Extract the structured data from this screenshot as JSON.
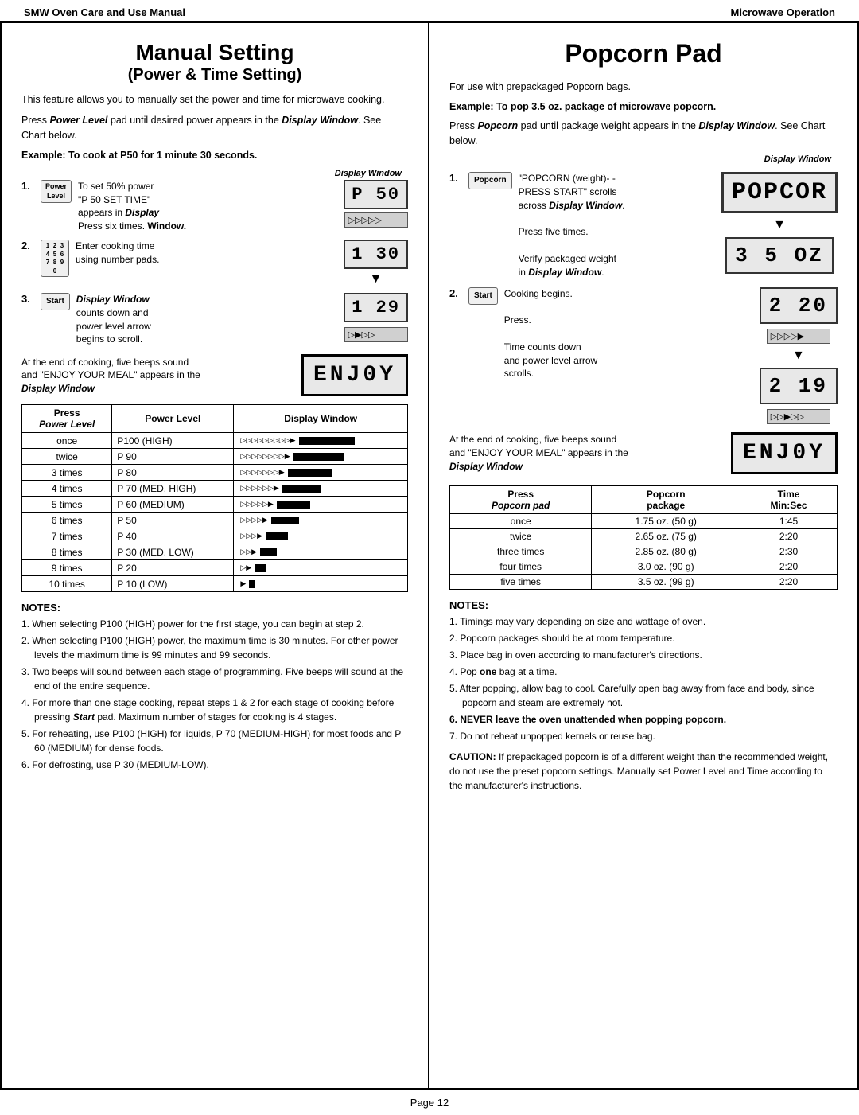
{
  "header": {
    "left": "SMW Oven Care and Use Manual",
    "right": "Microwave Operation"
  },
  "left": {
    "title_main": "Manual Setting",
    "title_sub": "(Power & Time Setting)",
    "intro1": "This feature allows you to manually set the power and time for microwave cooking.",
    "intro2": "Press Power Level pad until desired power appears in the Display Window. See Chart below.",
    "example_label": "Example: To cook at P50 for 1 minute 30 seconds.",
    "display_window_label": "Display Window",
    "steps": [
      {
        "num": "1.",
        "button": "Power\nLevel",
        "text_main": "To set 50% power\n\"P 50  SET TIME\"\nappears in ",
        "text_bold_italic": "Display",
        "text_after": "\nPress six times. ",
        "text_bold": "Window.",
        "display_val": "P 50",
        "display_val2": null
      },
      {
        "num": "2.",
        "button": "1 2 3\n4 5 6\n7 8 9\n0",
        "text_main": "Enter cooking time\nusing number pads.",
        "display_val": "1 30",
        "display_val2": null
      },
      {
        "num": "3.",
        "button": "Start",
        "text_label": "Display Window",
        "text_main": "counts down and\npower level arrow\nbegins to scroll.",
        "display_val": "1 29",
        "display_val2": null
      }
    ],
    "enjoy_text": "At the end of cooking, five beeps sound\nand \"ENJOY YOUR MEAL\" appears in the\nDisplay Window",
    "enjoy_val": "ENJ0Y",
    "power_table": {
      "headers": [
        "Press\nPower Level",
        "Power Level",
        "Display Window"
      ],
      "rows": [
        {
          "press": "once",
          "level": "P100 (HIGH)",
          "bars": 10
        },
        {
          "press": "twice",
          "level": "P 90",
          "bars": 9
        },
        {
          "press": "3 times",
          "level": "P 80",
          "bars": 8
        },
        {
          "press": "4 times",
          "level": "P 70 (MED. HIGH)",
          "bars": 7
        },
        {
          "press": "5 times",
          "level": "P 60 (MEDIUM)",
          "bars": 6
        },
        {
          "press": "6 times",
          "level": "P 50",
          "bars": 5
        },
        {
          "press": "7 times",
          "level": "P 40",
          "bars": 4
        },
        {
          "press": "8 times",
          "level": "P 30 (MED. LOW)",
          "bars": 3
        },
        {
          "press": "9 times",
          "level": "P 20",
          "bars": 2
        },
        {
          "press": "10 times",
          "level": "P 10 (LOW)",
          "bars": 1
        }
      ]
    },
    "notes_title": "NOTES:",
    "notes": [
      "1. When selecting P100 (HIGH) power for the first stage, you can begin at step 2.",
      "2. When selecting P100 (HIGH) power, the maximum time is 30 minutes. For other power levels the maximum time is 99 minutes and 99 seconds.",
      "3. Two beeps will sound between each stage of programming. Five beeps will sound at the end of the entire sequence.",
      "4. For more than one stage cooking, repeat steps 1 & 2 for each stage of cooking before pressing Start pad. Maximum number of stages for cooking is 4 stages.",
      "5. For reheating, use P100 (HIGH) for liquids, P 70 (MEDIUM-HIGH) for most foods and P 60 (MEDIUM) for dense foods.",
      "6. For defrosting, use P 30 (MEDIUM-LOW)."
    ]
  },
  "right": {
    "title": "Popcorn Pad",
    "intro": "For use with prepackaged Popcorn bags.",
    "example_label": "Example: To pop 3.5 oz. package of microwave popcorn.",
    "intro2_before": "Press ",
    "intro2_bold_italic": "Popcorn",
    "intro2_after": " pad until package weight appears in the ",
    "intro2_bold_italic2": "Display Window",
    "intro2_end": ". See Chart below.",
    "display_window_label": "Display Window",
    "steps": [
      {
        "num": "1.",
        "button": "Popcorn",
        "text1": "\"POPCORN (weight)- -\nPRESS START\" scrolls\nacross ",
        "text1_bold_italic": "Display Window",
        "text1_end": ".",
        "text2": "Press five times.",
        "text3": "Verify packaged weight\nin ",
        "text3_bold_italic": "Display Window",
        "text3_end": ".",
        "display_val1": "POPCOR",
        "display_val2": "3 5  02"
      },
      {
        "num": "2.",
        "button": "Start",
        "text1": "Cooking begins.",
        "display_val1": "2 20",
        "display_val2": "2 19"
      }
    ],
    "enjoy_text": "At the end of cooking, five beeps sound\nand \"ENJOY YOUR MEAL\" appears in the\nDisplay Window",
    "enjoy_val": "ENJ0Y",
    "popcorn_table": {
      "headers": [
        "Press\nPopcorn pad",
        "Popcorn\npackage",
        "Time\nMin:Sec"
      ],
      "rows": [
        {
          "press": "once",
          "package": "1.75 oz. (50 g)",
          "time": "1:45"
        },
        {
          "press": "twice",
          "package": "2.65 oz. (75 g)",
          "time": "2:20"
        },
        {
          "press": "three times",
          "package": "2.85 oz. (80 g)",
          "time": "2:30"
        },
        {
          "press": "four times",
          "package": "3.0 oz. (90 g) [strikethrough]",
          "time": "2:20"
        },
        {
          "press": "five times",
          "package": "3.5 oz. (99 g)",
          "time": "2:20"
        }
      ]
    },
    "notes_title": "NOTES:",
    "notes": [
      "1. Timings may vary depending on size and wattage of oven.",
      "2. Popcorn packages should be at room temperature.",
      "3. Place bag in oven according to manufacturer's directions.",
      "4. Pop one bag at a time.",
      "5. After popping, allow bag to cool. Carefully open bag away from face and body, since popcorn and steam are extremely hot.",
      "6. NEVER leave the oven unattended when popping popcorn.",
      "7. Do not reheat unpopped kernels or reuse bag."
    ],
    "caution": "CAUTION: If prepackaged popcorn is of a different weight than the recommended weight, do not use the preset popcorn settings. Manually set Power Level and Time according to the manufacturer's instructions."
  },
  "footer": {
    "page_label": "Page 12"
  }
}
